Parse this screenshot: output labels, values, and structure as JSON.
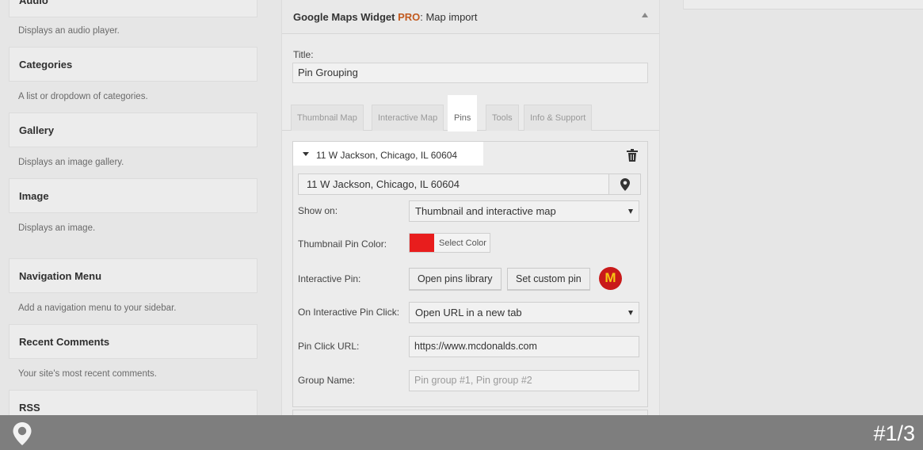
{
  "widgets": [
    {
      "title": "Audio",
      "desc": "Displays an audio player."
    },
    {
      "title": "Categories",
      "desc": "A list or dropdown of categories."
    },
    {
      "title": "Gallery",
      "desc": "Displays an image gallery."
    },
    {
      "title": "Image",
      "desc": "Displays an image."
    },
    {
      "title": "Navigation Menu",
      "desc": "Add a navigation menu to your sidebar."
    },
    {
      "title": "Recent Comments",
      "desc": "Your site's most recent comments."
    },
    {
      "title": "RSS",
      "desc": ""
    }
  ],
  "panel": {
    "title_main": "Google Maps Widget ",
    "title_pro": "PRO",
    "title_sub": ": Map import",
    "title_label": "Title:",
    "title_value": "Pin Grouping",
    "tabs": [
      {
        "label": "Thumbnail Map",
        "active": false
      },
      {
        "label": "Interactive Map",
        "active": false
      },
      {
        "label": "Pins",
        "active": true
      },
      {
        "label": "Tools",
        "active": false
      },
      {
        "label": "Info & Support",
        "active": false
      }
    ],
    "pin": {
      "header": "11 W Jackson, Chicago, IL 60604",
      "address": "11 W Jackson, Chicago, IL 60604",
      "show_on_label": "Show on:",
      "show_on_value": "Thumbnail and interactive map",
      "thumb_color_label": "Thumbnail Pin Color:",
      "thumb_color": "#e81d1d",
      "select_color_label": "Select Color",
      "interactive_pin_label": "Interactive Pin:",
      "open_library_label": "Open pins library",
      "set_custom_label": "Set custom pin",
      "custom_pin_glyph": "M",
      "click_label": "On Interactive Pin Click:",
      "click_value": "Open URL in a new tab",
      "url_label": "Pin Click URL:",
      "url_value": "https://www.mcdonalds.com",
      "group_label": "Group Name:",
      "group_placeholder": "Pin group #1, Pin group #2"
    }
  },
  "footer": {
    "counter": "#1/3"
  }
}
